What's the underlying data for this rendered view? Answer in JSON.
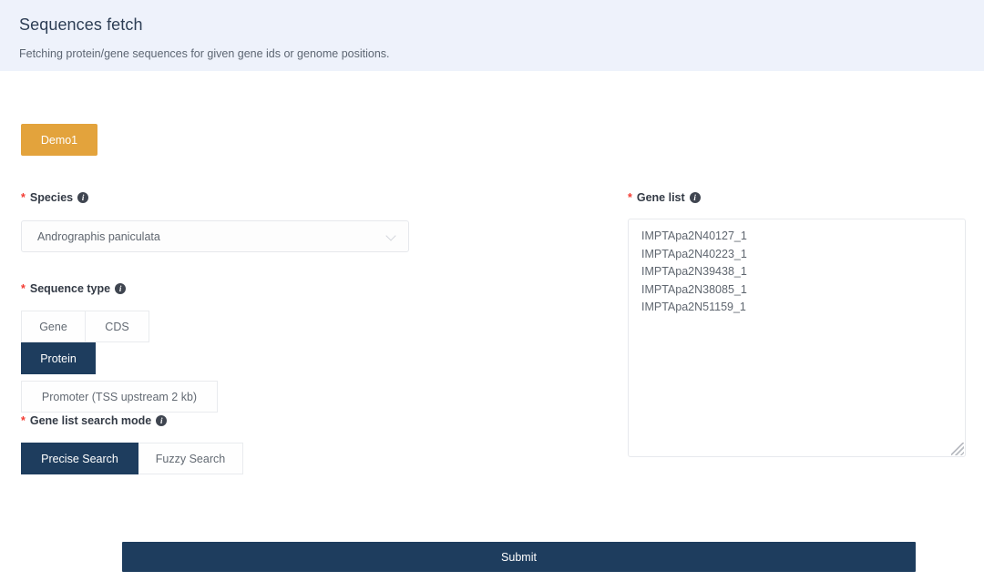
{
  "header": {
    "title": "Sequences fetch",
    "subtitle": "Fetching protein/gene sequences for given gene ids or genome positions."
  },
  "demo": {
    "label": "Demo1"
  },
  "species": {
    "label": "Species",
    "required_mark": "*",
    "info_glyph": "i",
    "selected": "Andrographis paniculata",
    "chevron_icon": "chevron-down-icon"
  },
  "sequence_type": {
    "label": "Sequence type",
    "required_mark": "*",
    "info_glyph": "i",
    "options": [
      {
        "label": "Gene",
        "selected": false
      },
      {
        "label": "CDS",
        "selected": false
      },
      {
        "label": "Protein",
        "selected": true
      },
      {
        "label": "Promoter (TSS upstream 2 kb)",
        "selected": false
      }
    ]
  },
  "search_mode": {
    "label": "Gene list search mode",
    "required_mark": "*",
    "info_glyph": "i",
    "options": [
      {
        "label": "Precise Search",
        "selected": true
      },
      {
        "label": "Fuzzy Search",
        "selected": false
      }
    ]
  },
  "gene_list": {
    "label": "Gene list",
    "required_mark": "*",
    "info_glyph": "i",
    "value": "IMPTApa2N40127_1\nIMPTApa2N40223_1\nIMPTApa2N39438_1\nIMPTApa2N38085_1\nIMPTApa2N51159_1",
    "entries": [
      "IMPTApa2N40127_1",
      "IMPTApa2N40223_1",
      "IMPTApa2N39438_1",
      "IMPTApa2N38085_1",
      "IMPTApa2N51159_1"
    ]
  },
  "submit": {
    "label": "Submit"
  },
  "colors": {
    "header_band": "#eef2fb",
    "accent_navy": "#1e3d5e",
    "demo_orange": "#e3a33c",
    "required_red": "#f33b32",
    "border_gray": "#e7e9ed",
    "text_gray": "#5f666f"
  }
}
